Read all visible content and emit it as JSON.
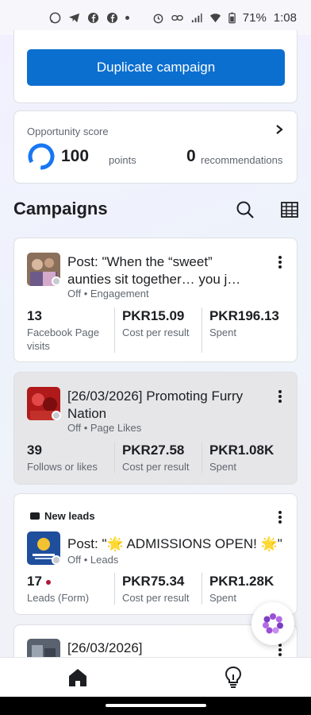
{
  "status_bar": {
    "battery": "71%",
    "time": "1:08",
    "left_icons": [
      "whatsapp-icon",
      "telegram-icon",
      "facebook-icon",
      "facebook-icon",
      "dot"
    ],
    "right_icons": [
      "alarm-icon",
      "link-icon",
      "signal-icon",
      "wifi-icon",
      "battery-icon"
    ]
  },
  "duplicate": {
    "label": "Duplicate campaign"
  },
  "opportunity": {
    "title": "Opportunity score",
    "points_value": "100",
    "points_label": "points",
    "recommendations_value": "0",
    "recommendations_label": "recommendations"
  },
  "campaigns": {
    "title": "Campaigns",
    "items": [
      {
        "title": "Post: \"When the “sweet” aunties sit together… you j…",
        "status": "Off",
        "objective": "Engagement",
        "metrics": [
          {
            "value": "13",
            "label": "Facebook Page visits"
          },
          {
            "value": "PKR15.09",
            "label": "Cost per result"
          },
          {
            "value": "PKR196.13",
            "label": "Spent"
          }
        ]
      },
      {
        "title": "[26/03/2026] Promoting Furry Nation",
        "status": "Off",
        "objective": "Page Likes",
        "metrics": [
          {
            "value": "39",
            "label": "Follows or likes"
          },
          {
            "value": "PKR27.58",
            "label": "Cost per result"
          },
          {
            "value": "PKR1.08K",
            "label": "Spent"
          }
        ]
      },
      {
        "badge": "New leads",
        "title": "Post: \"🌟 ADMISSIONS OPEN! 🌟\"",
        "status": "Off",
        "objective": "Leads",
        "metrics": [
          {
            "value": "17",
            "label": "Leads (Form)"
          },
          {
            "value": "PKR75.34",
            "label": "Cost per result"
          },
          {
            "value": "PKR1.28K",
            "label": "Spent"
          }
        ]
      },
      {
        "title": "[26/03/2026]"
      }
    ]
  },
  "colors": {
    "primary": "#0b6fd0",
    "ring": "#1877f2",
    "lead_dot": "#b0173a"
  }
}
